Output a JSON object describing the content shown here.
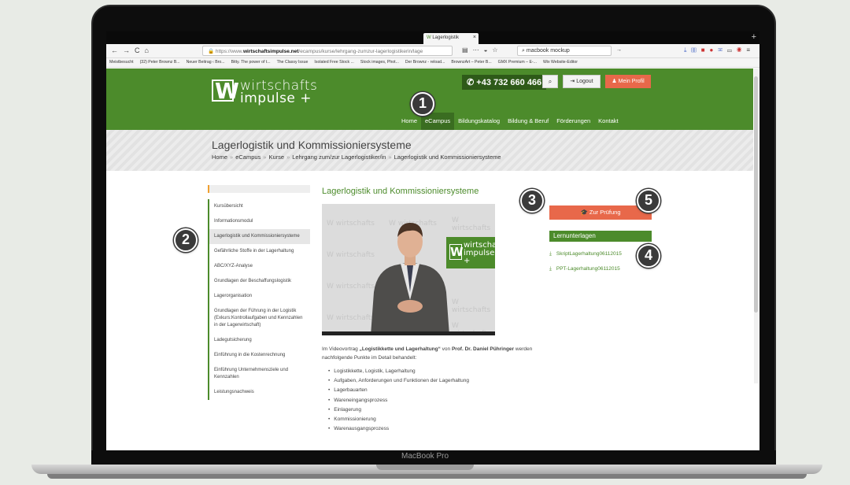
{
  "device": {
    "label": "MacBook Pro"
  },
  "browser": {
    "tab_title": "Lagerlogistik",
    "tab_close": "×",
    "new_tab": "+",
    "nav": {
      "back": "←",
      "forward": "→",
      "reload": "C",
      "home": "⌂"
    },
    "url_prefix": "https://www.",
    "url_domain": "wirtschaftsimpulse.net",
    "url_path": "/ecampus/kurse/lehrgang-zumzur-lagerlogistikerin/lage",
    "search_value": "macbook mockup",
    "bookmarks": [
      "Meistbesucht",
      "(32) Peter Brownz B...",
      "Neuer Beitrag ‹ Bro...",
      "Bitty. The power of t...",
      "The Classy Issue",
      "Isolated Free Stock ...",
      "Stock images, Phot...",
      "Der Brownz - reload...",
      "BrownzArt – Peter B...",
      "GMX Premium – E-...",
      "Wix Website-Editor"
    ]
  },
  "header": {
    "logo_line1": "wirtschafts",
    "logo_line2": "impulse  +",
    "logo_mark": "W",
    "phone": "+43 732 660 466",
    "logout": "Logout",
    "profile": "Mein Profil",
    "nav": [
      "Home",
      "eCampus",
      "Bildungskatalog",
      "Bildung & Beruf",
      "Förderungen",
      "Kontakt"
    ],
    "active_nav": "eCampus"
  },
  "title_band": {
    "title": "Lagerlogistik und Kommissioniersysteme",
    "breadcrumb": [
      "Home",
      "eCampus",
      "Kurse",
      "Lehrgang zum/zur Lagerlogistiker/in",
      "Lagerlogistik und Kommissioniersysteme"
    ]
  },
  "sidebar": {
    "items": [
      "Kursübersicht",
      "Informationsmodul",
      "Lagerlogistik und Kommissioniersysteme",
      "Gefährliche Stoffe in der Lagerhaltung",
      "ABC/XYZ-Analyse",
      "Grundlagen der Beschaffungslogistik",
      "Lagerorganisation",
      "Grundlagen der Führung in der Logistik (Exkurs:Kontrollaufgaben und Kennzahlen in der Lagerwirtschaft)",
      "Ladegutsicherung",
      "Einführung in die Kostenrechnung",
      "Einführung Unternehmensziele und Kennzahlen",
      "Leistungsnachweis"
    ],
    "active_index": 2
  },
  "main": {
    "title": "Lagerlogistik und Kommissioniersysteme",
    "video_badge_line1": "wirtschafts",
    "video_badge_line2": "impulse  +",
    "desc_pre": "Im Videovortrag ",
    "desc_bold1": "„Logistikkette und Lagerhaltung“",
    "desc_mid": " von ",
    "desc_bold2": "Prof. Dr. Daniel Pühringer",
    "desc_post": " werden nachfolgende Punkte im Detail behandelt:",
    "bullets": [
      "Logistikkette, Logistik, Lagerhaltung",
      "Aufgaben, Anforderungen und Funktionen der Lagerhaltung",
      "Lagerbauarten",
      "Wareneingangsprozess",
      "Einlagerung",
      "Kommissionierung",
      "Warenausgangsprozess"
    ]
  },
  "aside": {
    "exam_button": "Zur Prüfung",
    "materials_title": "Lernunterlagen",
    "downloads": [
      "SkriptLagerhaltung06112015",
      "PPT-Lagerhaltung06112015"
    ]
  },
  "annotations": [
    "1",
    "2",
    "3",
    "4",
    "5"
  ],
  "colors": {
    "brand_green": "#4c8b2b",
    "accent_orange": "#e8684a"
  }
}
